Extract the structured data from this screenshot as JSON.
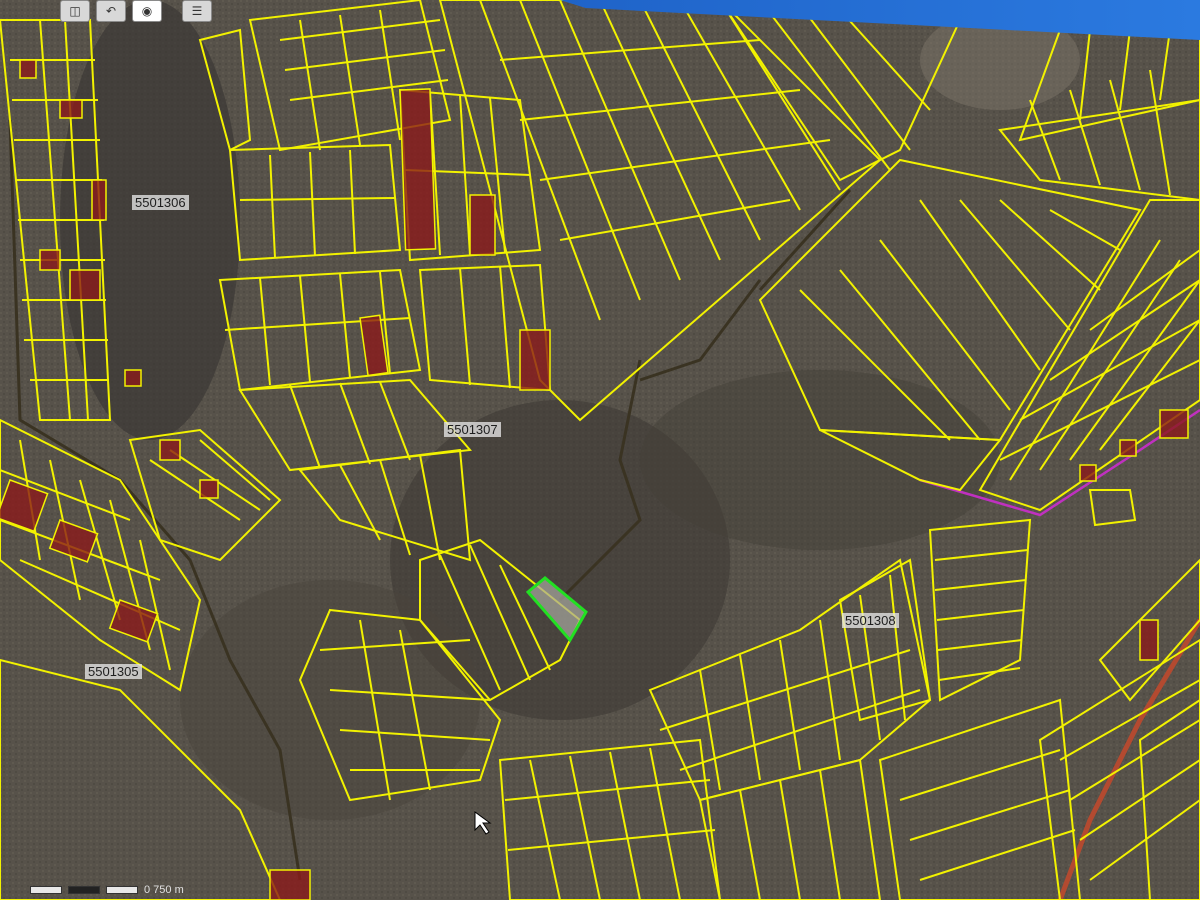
{
  "toolbar": {
    "buttons": [
      {
        "icon": "select-icon"
      },
      {
        "icon": "undo-icon"
      },
      {
        "icon": "info-icon"
      },
      {
        "icon": "layers-icon"
      }
    ]
  },
  "map": {
    "block_labels": [
      "5501306",
      "5501307",
      "5501308",
      "5501305"
    ],
    "scale_text": "0  750 m"
  },
  "colors": {
    "parcel_outline": "#f2f200",
    "registered_parcel_fill": "#8b1a1a",
    "selected_parcel": "#22e022",
    "block_boundary": "#3a3322",
    "admin_boundary": "#c030c0",
    "road": "#b34a30",
    "screen_bezel": "#2b73d9"
  }
}
